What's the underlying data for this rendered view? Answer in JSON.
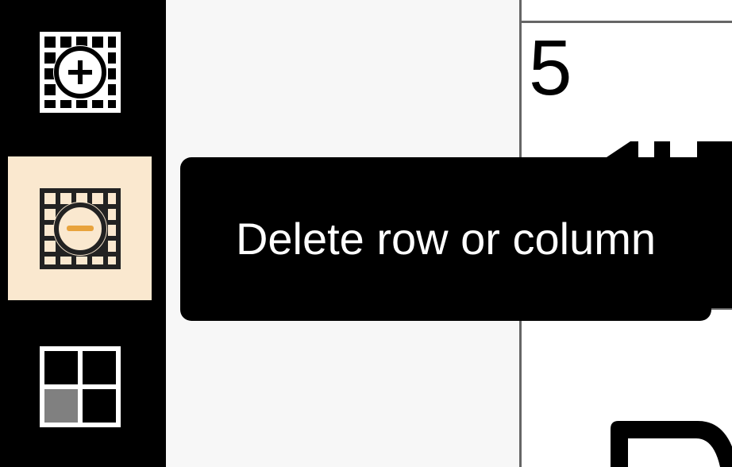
{
  "toolbar": {
    "items": [
      {
        "icon": "grid-insert-icon",
        "active": false
      },
      {
        "icon": "grid-delete-icon",
        "active": true
      },
      {
        "icon": "grid-merge-icon",
        "active": false
      }
    ],
    "accent_color": "#e8a33d",
    "active_background": "#fae8cf"
  },
  "sheet": {
    "cell_value": "5"
  },
  "tooltip": {
    "text": "Delete row or column"
  }
}
